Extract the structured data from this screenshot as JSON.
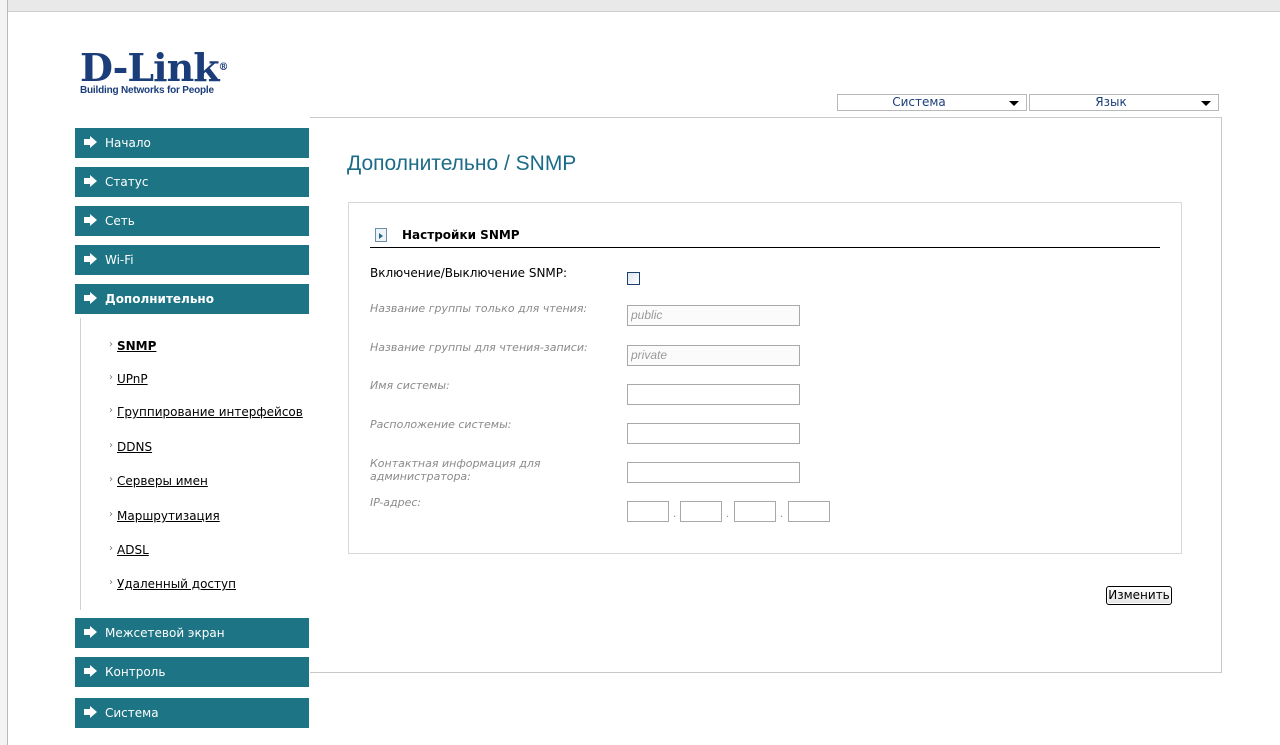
{
  "brand": {
    "logo_text": "D-Link",
    "tagline": "Building Networks for People"
  },
  "top_selects": {
    "system": "Система",
    "language": "Язык"
  },
  "sidebar": {
    "top_items": [
      {
        "label": "Начало"
      },
      {
        "label": "Статус"
      },
      {
        "label": "Сеть"
      },
      {
        "label": "Wi-Fi"
      },
      {
        "label": "Дополнительно"
      }
    ],
    "subitems": [
      {
        "label": "SNMP",
        "active": true
      },
      {
        "label": "UPnP"
      },
      {
        "label": "Группирование интерфейсов"
      },
      {
        "label": "DDNS"
      },
      {
        "label": "Серверы имен"
      },
      {
        "label": "Маршрутизация"
      },
      {
        "label": "ADSL"
      },
      {
        "label": "Удаленный доступ"
      }
    ],
    "bottom_items": [
      {
        "label": "Межсетевой экран"
      },
      {
        "label": "Контроль"
      },
      {
        "label": "Система"
      }
    ]
  },
  "page": {
    "title": "Дополнительно /  SNMP",
    "section_title": "Настройки SNMP",
    "enable_label": "Включение/Выключение SNMP:",
    "enable_checked": false,
    "ro_label": "Название группы только для чтения:",
    "ro_value": "public",
    "rw_label": "Название группы для чтения-записи:",
    "rw_value": "private",
    "sysname_label": "Имя системы:",
    "sysname_value": "",
    "location_label": "Расположение системы:",
    "location_value": "",
    "contact_label": "Контактная информация для администратора:",
    "contact_value": "",
    "ip_label": "IP-адрес:",
    "ip_sep": ".",
    "ip_octets": [
      "",
      "",
      "",
      ""
    ],
    "submit": "Изменить"
  },
  "colors": {
    "nav_bg": "#1c7484",
    "title": "#1c6b88",
    "brand": "#1b3e7a"
  }
}
